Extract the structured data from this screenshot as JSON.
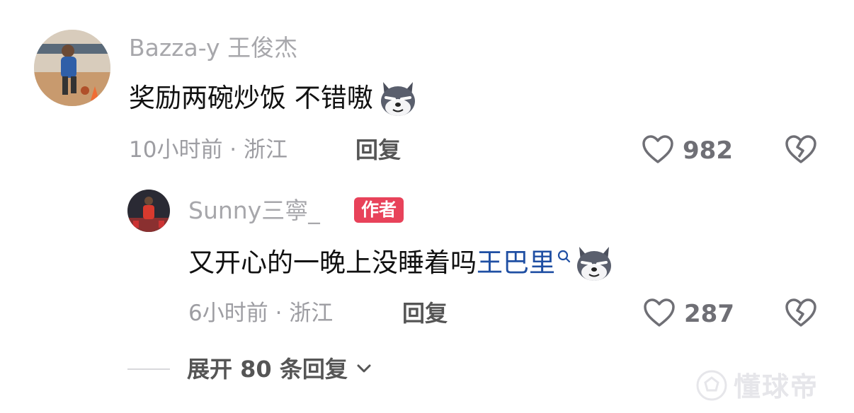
{
  "comments": [
    {
      "username": "Bazza-y 王俊杰",
      "text": "奖励两碗炒饭 不错嗷",
      "emoji_icon": "wolf-face-icon",
      "meta": "10小时前 · 浙江",
      "reply_label": "回复",
      "likes": "982"
    }
  ],
  "reply": {
    "username": "Sunny三寧_",
    "author_badge": "作者",
    "text": "又开心的一晚上没睡着吗",
    "mention": "王巴里",
    "emoji_icon": "wolf-face-icon",
    "meta": "6小时前 · 浙江",
    "reply_label": "回复",
    "likes": "287"
  },
  "expand": {
    "label": "展开 80 条回复"
  },
  "watermark": {
    "text": "懂球帝"
  },
  "colors": {
    "badge": "#e8425a",
    "mention": "#1f4fa3",
    "meta_gray": "#9d9da2"
  }
}
